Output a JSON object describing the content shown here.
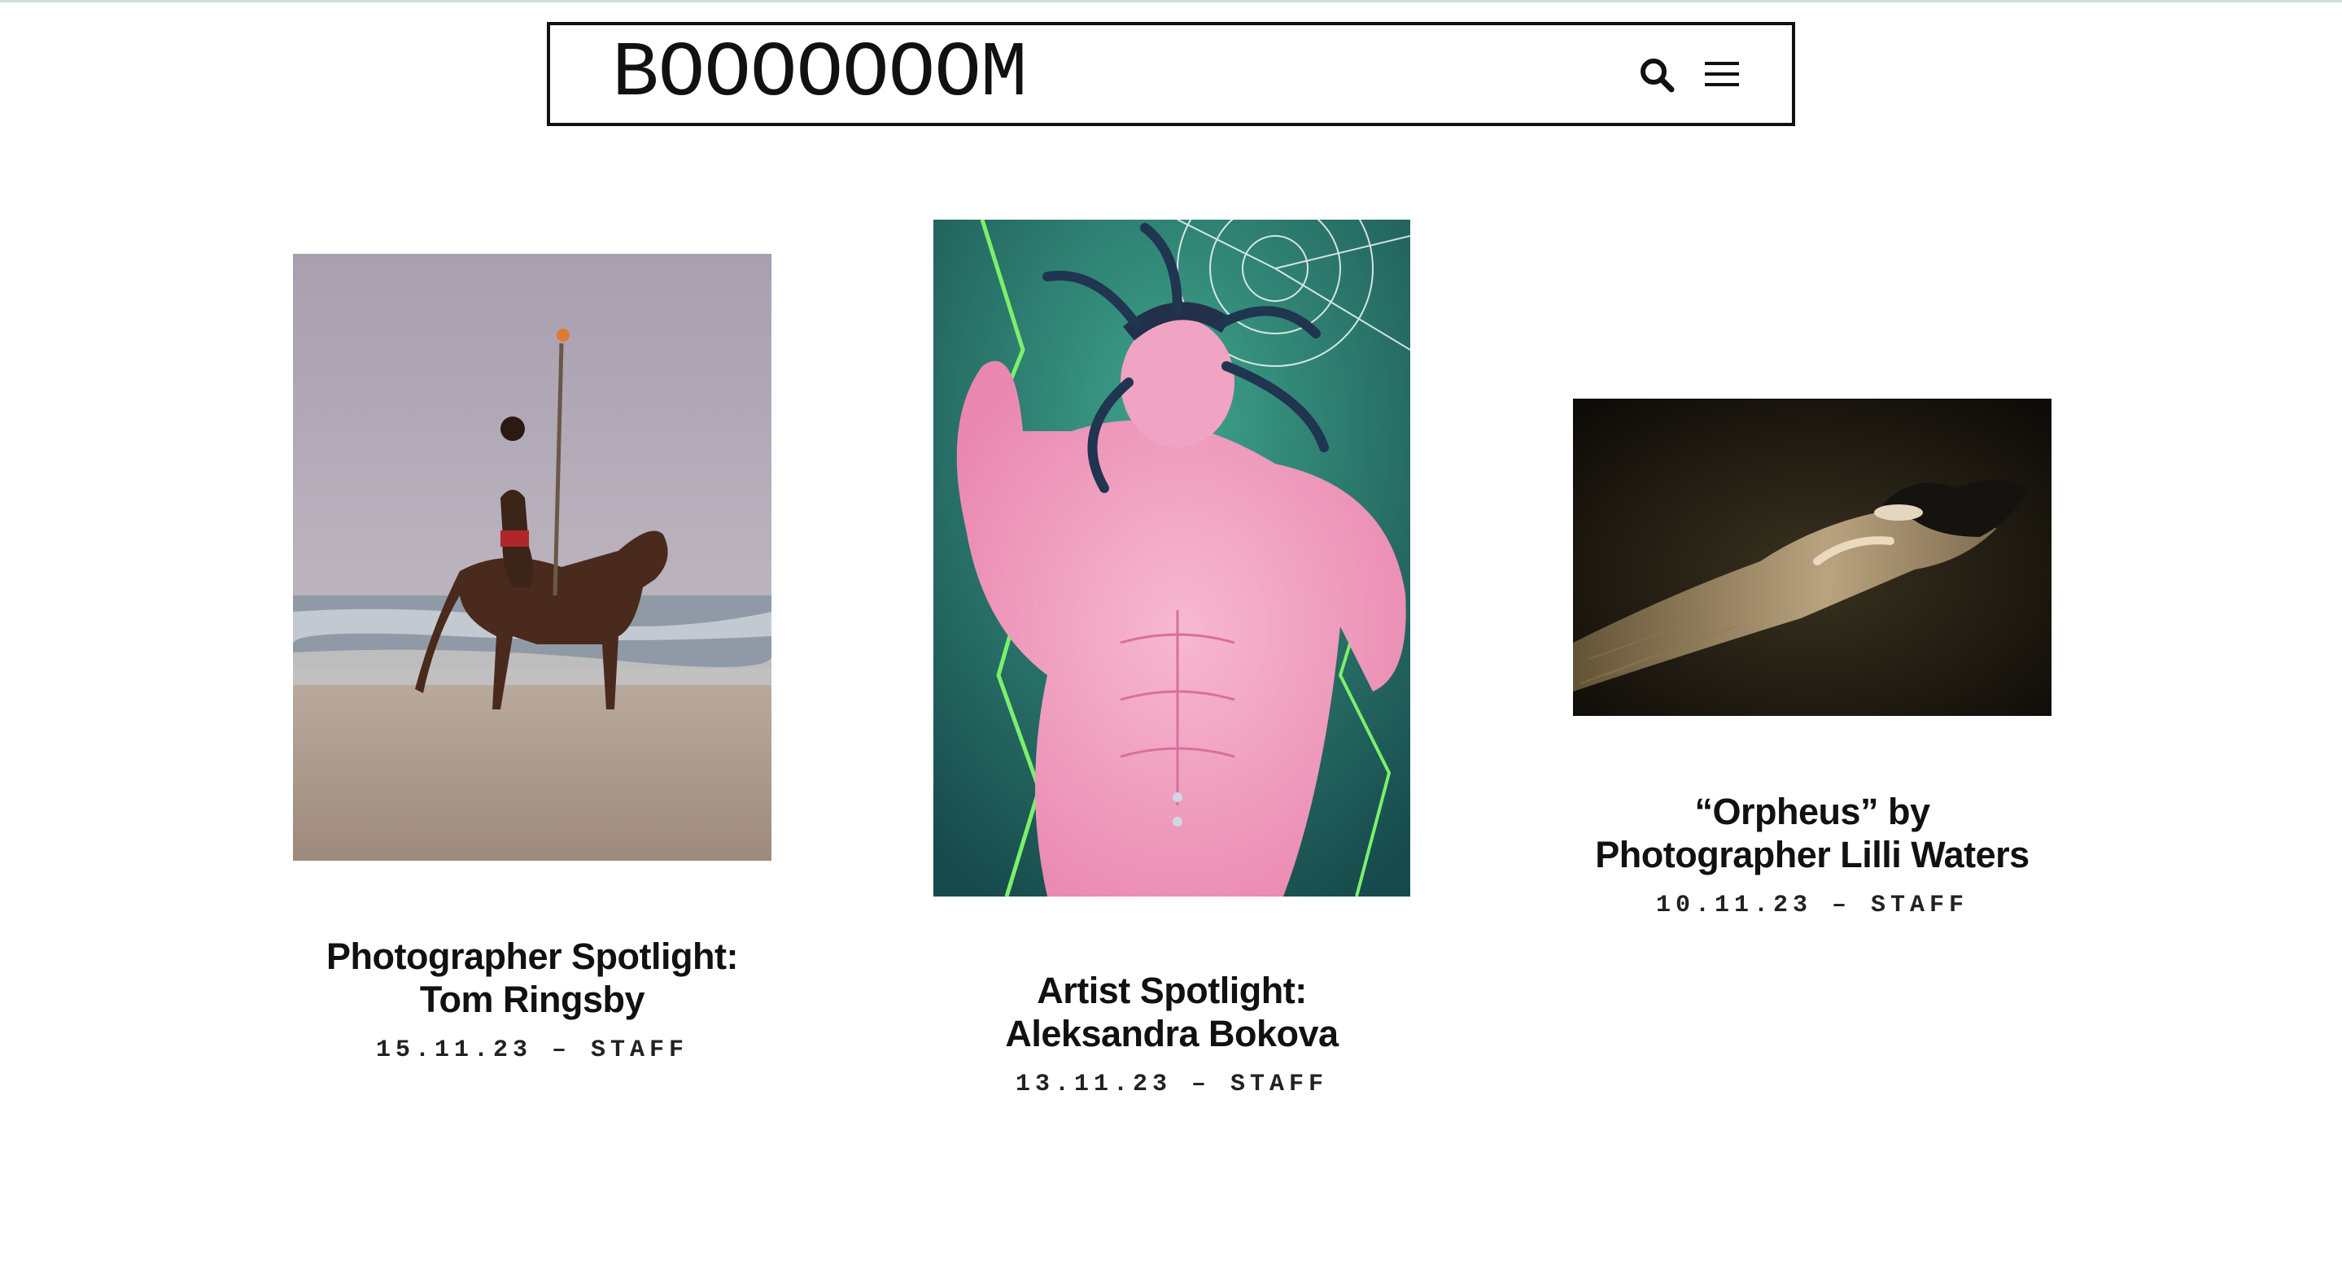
{
  "header": {
    "logo": "BOOOOOOOM",
    "search_icon": "search-icon",
    "menu_icon": "hamburger-menu-icon"
  },
  "posts": [
    {
      "title_line1": "Photographer Spotlight:",
      "title_line2": "Tom Ringsby",
      "date": "15.11.23",
      "separator": "–",
      "author": "STAFF"
    },
    {
      "title_line1": "Artist Spotlight:",
      "title_line2": "Aleksandra Bokova",
      "date": "13.11.23",
      "separator": "–",
      "author": "STAFF"
    },
    {
      "title_line1": "“Orpheus” by",
      "title_line2": "Photographer Lilli Waters",
      "date": "10.11.23",
      "separator": "–",
      "author": "STAFF"
    }
  ],
  "colors": {
    "accent_rule": "#cfdedd",
    "text": "#111111"
  }
}
